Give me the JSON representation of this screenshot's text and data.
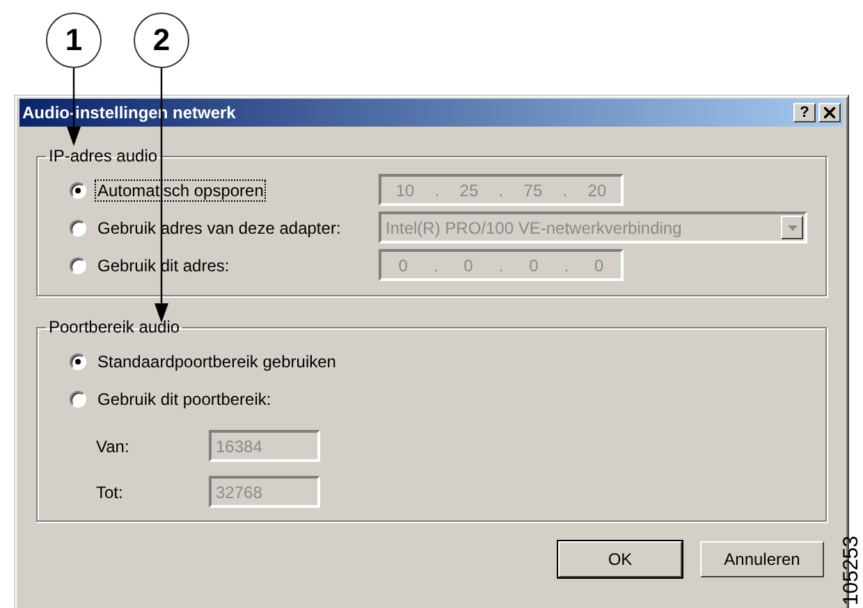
{
  "callouts": [
    {
      "number": "1"
    },
    {
      "number": "2"
    }
  ],
  "dialog": {
    "title": "Audio-instellingen netwerk",
    "help_button": "?",
    "ip_group": {
      "legend": "IP-adres audio",
      "separator": ".",
      "options": [
        {
          "label": "Automatisch opsporen",
          "selected": true,
          "focused": true,
          "kind": "ip",
          "octets": [
            "10",
            "25",
            "75",
            "20"
          ],
          "disabled": true
        },
        {
          "label": "Gebruik adres van deze adapter:",
          "selected": false,
          "focused": false,
          "kind": "dropdown",
          "value": "Intel(R) PRO/100 VE-netwerkverbinding",
          "disabled": true
        },
        {
          "label": "Gebruik dit adres:",
          "selected": false,
          "focused": false,
          "kind": "ip",
          "octets": [
            "0",
            "0",
            "0",
            "0"
          ],
          "disabled": true
        }
      ]
    },
    "port_group": {
      "legend": "Poortbereik audio",
      "options": [
        {
          "label": "Standaardpoortbereik gebruiken",
          "selected": true
        },
        {
          "label": "Gebruik dit poortbereik:",
          "selected": false
        }
      ],
      "fields": [
        {
          "label": "Van:",
          "value": "16384",
          "disabled": true
        },
        {
          "label": "Tot:",
          "value": "32768",
          "disabled": true
        }
      ]
    },
    "buttons": [
      {
        "label": "OK",
        "default": true
      },
      {
        "label": "Annuleren",
        "default": false
      }
    ]
  },
  "figure_number": "105253"
}
